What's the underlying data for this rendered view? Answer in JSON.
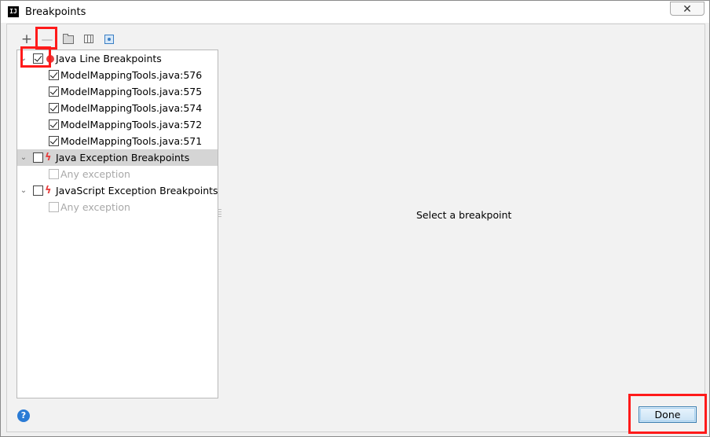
{
  "window": {
    "title": "Breakpoints",
    "icon": "intellij-logo",
    "app_icon_text": "IJ",
    "close_glyph": "✕"
  },
  "toolbar": {
    "add": {
      "icon": "plus-icon",
      "glyph": "+"
    },
    "remove": {
      "icon": "minus-icon",
      "glyph": "—"
    },
    "folder": {
      "icon": "folder-icon"
    },
    "group": {
      "icon": "group-by-icon"
    },
    "export": {
      "icon": "export-icon"
    }
  },
  "tree": {
    "groups": [
      {
        "label": "Java Line Breakpoints",
        "checked": true,
        "expanded": true,
        "icon": "red-dot-icon",
        "items": [
          {
            "label": "ModelMappingTools.java:576",
            "checked": true
          },
          {
            "label": "ModelMappingTools.java:575",
            "checked": true
          },
          {
            "label": "ModelMappingTools.java:574",
            "checked": true
          },
          {
            "label": "ModelMappingTools.java:572",
            "checked": true
          },
          {
            "label": "ModelMappingTools.java:571",
            "checked": true
          }
        ]
      },
      {
        "label": "Java Exception Breakpoints",
        "checked": false,
        "expanded": true,
        "selected": true,
        "icon": "lightning-icon",
        "items": [
          {
            "label": "Any exception",
            "checked": false,
            "disabled": true
          }
        ]
      },
      {
        "label": "JavaScript Exception Breakpoints",
        "checked": false,
        "expanded": true,
        "icon": "lightning-icon",
        "items": [
          {
            "label": "Any exception",
            "checked": false,
            "disabled": true
          }
        ]
      }
    ],
    "expand_glyph": "⌄",
    "bolt_glyph": "ϟ"
  },
  "details": {
    "placeholder": "Select a breakpoint"
  },
  "footer": {
    "help_glyph": "?",
    "done_label": "Done"
  },
  "colors": {
    "highlight": "#ff1a1a",
    "breakpoint": "#e53d3d",
    "selection": "#d5d5d5",
    "help": "#2a7bd5"
  }
}
